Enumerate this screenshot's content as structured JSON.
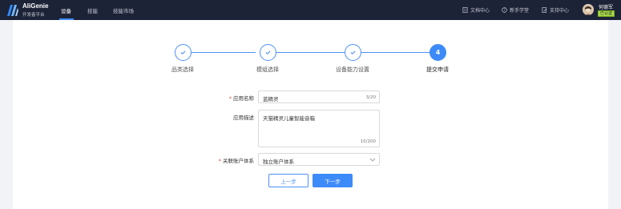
{
  "header": {
    "brand_name": "AliGenie",
    "brand_sub": "开发者平台",
    "nav": [
      {
        "label": "设备",
        "active": true
      },
      {
        "label": "技能",
        "active": false
      },
      {
        "label": "技能市场",
        "active": false
      }
    ],
    "links": [
      {
        "label": "文档中心",
        "icon": "document-icon"
      },
      {
        "label": "新手学堂",
        "icon": "help-circle-icon"
      },
      {
        "label": "支持中心",
        "icon": "support-icon"
      }
    ],
    "user": {
      "name": "何德军",
      "badge": "已认证"
    }
  },
  "steps": [
    {
      "label": "品类选择",
      "status": "done"
    },
    {
      "label": "模组选择",
      "status": "done"
    },
    {
      "label": "设备能力设置",
      "status": "done"
    },
    {
      "label": "提交申请",
      "status": "current",
      "number": "4"
    }
  ],
  "form": {
    "app_name": {
      "label": "应用名称",
      "required": true,
      "value": "蓝精灵",
      "count": "3/20"
    },
    "app_desc": {
      "label": "应用描述",
      "required": false,
      "value": "天猫精灵儿童智能音箱",
      "count": "10/200"
    },
    "account": {
      "label": "关联账户体系",
      "required": true,
      "value": "独立账户体系"
    }
  },
  "buttons": {
    "prev": "上一步",
    "next": "下一步"
  },
  "colors": {
    "accent": "#3d8bf8",
    "topbar": "#1d2337",
    "required": "#f04134"
  }
}
